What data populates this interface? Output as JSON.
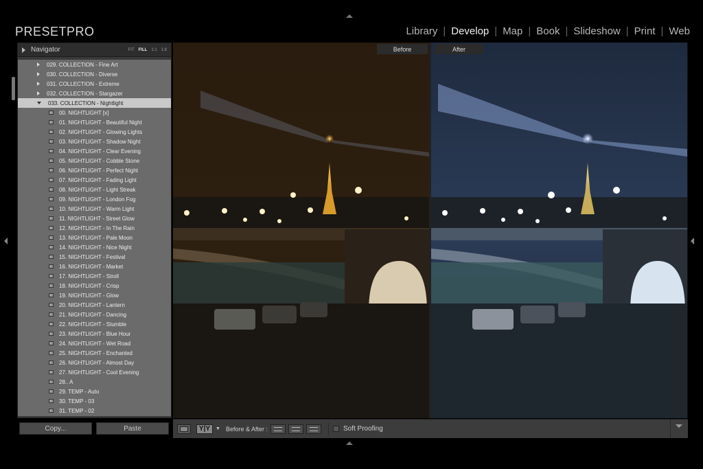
{
  "brand": "PRESETPRO",
  "modules": [
    {
      "label": "Library",
      "active": false
    },
    {
      "label": "Develop",
      "active": true
    },
    {
      "label": "Map",
      "active": false
    },
    {
      "label": "Book",
      "active": false
    },
    {
      "label": "Slideshow",
      "active": false
    },
    {
      "label": "Print",
      "active": false
    },
    {
      "label": "Web",
      "active": false
    }
  ],
  "navigator": {
    "title": "Navigator",
    "zoom_options": [
      "FIT",
      "FILL",
      "1:1",
      "1:8"
    ],
    "selected_zoom": "FILL"
  },
  "collections": [
    "029. COLLECTION - Fine Art",
    "030. COLLECTION - Diverse",
    "031. COLLECTION - Extreme",
    "032. COLLECTION - Stargazer"
  ],
  "open_collection": "033. COLLECTION - Nightlight",
  "presets": [
    "00. NIGHTLIGHT [x]",
    "01. NIGHTLIGHT - Beautiful Night",
    "02. NIGHTLIGHT - Glowing Lights",
    "03. NIGHTLIGHT - Shadow Night",
    "04. NIGHTLIGHT - Clear Evening",
    "05. NIGHTLIGHT - Cobble Stone",
    "06. NIGHTLIGHT - Perfect Night",
    "07. NIGHTLIGHT - Fading Light",
    "08. NIGHTLIGHT - Light Streak",
    "09. NIGHTLIGHT - London Fog",
    "10. NIGHTLIGHT - Warm Light",
    "11. NIGHTLIGHT - Street Glow",
    "12. NIGHTLIGHT - In The Rain",
    "13. NIGHTLIGHT - Pale Moon",
    "14. NIGHTLIGHT - Nice Night",
    "15. NIGHTLIGHT - Festival",
    "16. NIGHTLIGHT - Market",
    "17. NIGHTLIGHT - Stroll",
    "18. NIGHTLIGHT - Crisp",
    "19. NIGHTLIGHT - Glow",
    "20. NIGHTLIGHT - Lantern",
    "21. NIGHTLIGHT - Dancing",
    "22. NIGHTLIGHT - Stumble",
    "23. NIGHTLIGHT - Blue Hour",
    "24. NIGHTLIGHT - Wet Road",
    "25. NIGHTLIGHT - Enchanted",
    "26. NIGHTLIGHT - Almost Day",
    "27. NIGHTLIGHT - Cool Evening",
    "28.. A",
    "29. TEMP - Auto",
    "30. TEMP - 03",
    "31. TEMP - 02"
  ],
  "buttons": {
    "copy": "Copy...",
    "paste": "Paste"
  },
  "view": {
    "before_label": "Before",
    "after_label": "After"
  },
  "toolbar": {
    "yy_label": "Y|Y",
    "before_after_label": "Before & After :",
    "soft_proofing_label": "Soft Proofing"
  },
  "colors": {
    "panel_bg": "#6b6b6b",
    "selected_row": "#c9c9c9",
    "app_bg": "#000000"
  }
}
